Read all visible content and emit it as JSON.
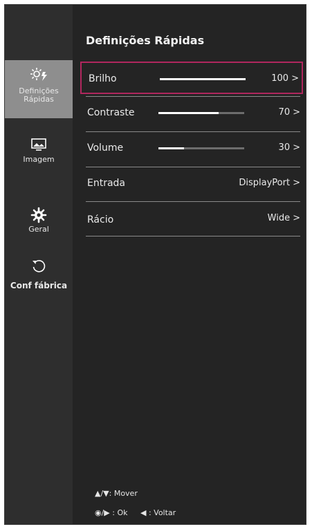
{
  "sidebar": {
    "items": [
      {
        "label_line1": "Definições",
        "label_line2": "Rápidas",
        "icon": "quick-settings-icon",
        "active": true
      },
      {
        "label": "Imagem",
        "icon": "picture-icon"
      },
      {
        "label": "Geral",
        "icon": "gear-icon"
      },
      {
        "label": "Conf fábrica",
        "icon": "reset-icon"
      }
    ]
  },
  "main": {
    "title": "Definições Rápidas",
    "rows": [
      {
        "label": "Brilho",
        "value": "100",
        "chevron": ">",
        "level": 1.0,
        "selected": true
      },
      {
        "label": "Contraste",
        "value": "70",
        "chevron": ">",
        "level": 0.7
      },
      {
        "label": "Volume",
        "value": "30",
        "chevron": ">",
        "level": 0.3
      },
      {
        "label": "Entrada",
        "value": "DisplayPort",
        "chevron": ">"
      },
      {
        "label": "Rácio",
        "value": "Wide",
        "chevron": ">"
      }
    ]
  },
  "hints": {
    "move": "▲/▼: Mover",
    "ok": "◉/▶ : Ok",
    "back": "◀ : Voltar"
  },
  "colors": {
    "panel": "#242424",
    "sidebar": "#2e2e2e",
    "active_item": "#8e8e8e",
    "selection_border": "#b0275e",
    "slider_fill": "#ffffff",
    "slider_track": "#6d6d6d"
  }
}
